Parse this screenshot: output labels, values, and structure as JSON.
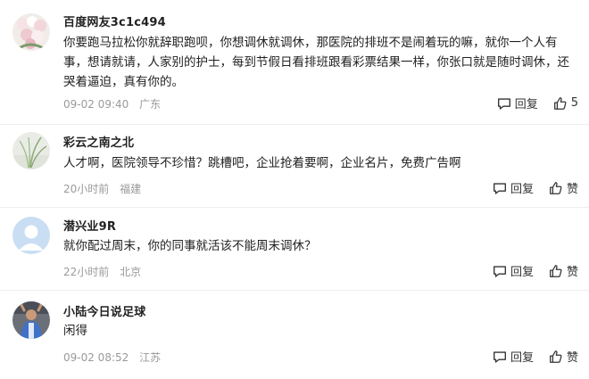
{
  "comments": [
    {
      "username": "百度网友3c1c494",
      "text": "你要跑马拉松你就辞职跑呗，你想调休就调休，那医院的排班不是闹着玩的嘛，就你一个人有事，想请就请，人家别的护士，每到节假日看排班跟看彩票结果一样，你张口就是随时调休，还哭着逼迫，真有你的。",
      "time": "09-02 09:40",
      "location": "广东",
      "reply_label": "回复",
      "like_count": "5",
      "avatar_icon": "flowers-avatar"
    },
    {
      "username": "彩云之南之北",
      "text": "人才啊，医院领导不珍惜？跳槽吧，企业抢着要啊，企业名片，免费广告啊",
      "time": "20小时前",
      "location": "福建",
      "reply_label": "回复",
      "like_label": "赞",
      "avatar_icon": "grass-avatar"
    },
    {
      "username": "潜兴业9R",
      "text": "就你配过周末，你的同事就活该不能周末调休？",
      "time": "22小时前",
      "location": "北京",
      "reply_label": "回复",
      "like_label": "赞",
      "avatar_icon": "default-person-avatar"
    },
    {
      "username": "小陆今日说足球",
      "text": "闲得",
      "time": "09-02 08:52",
      "location": "江苏",
      "reply_label": "回复",
      "like_label": "赞",
      "avatar_icon": "football-avatar"
    }
  ],
  "colors": {
    "text": "#222222",
    "meta": "#9a9a9a",
    "divider": "#eeeeee"
  }
}
